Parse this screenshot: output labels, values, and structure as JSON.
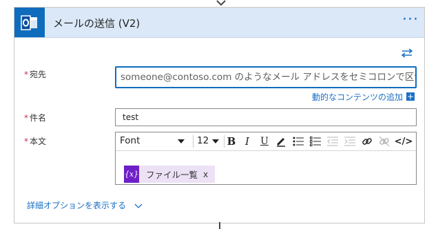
{
  "action": {
    "title": "メールの送信 (V2)",
    "more_label": "···",
    "icon": "outlook-icon",
    "icon_letter": "o"
  },
  "fields": {
    "to": {
      "required_mark": "*",
      "label": "宛先",
      "placeholder": "someone@contoso.com のようなメール アドレスをセミコロンで区切って指定し"
    },
    "dynamic_content": {
      "label": "動的なコンテンツの追加",
      "plus": "+"
    },
    "subject": {
      "required_mark": "*",
      "label": "件名",
      "value": "test"
    },
    "body": {
      "required_mark": "*",
      "label": "本文",
      "toolbar": {
        "font_label": "Font",
        "size_label": "12",
        "bold": "B",
        "italic": "I",
        "underline": "U",
        "code": "</>"
      },
      "token": {
        "icon_text": "{x}",
        "label": "ファイル一覧",
        "remove": "x"
      }
    }
  },
  "advanced": {
    "label": "詳細オプションを表示する"
  },
  "colors": {
    "accent": "#0f6cbd",
    "header_bg": "#dbe8f7",
    "link": "#1a6fc4",
    "required": "#c4314b",
    "token_bg": "#ece1f5",
    "token_icon_bg": "#6f1fc7"
  }
}
